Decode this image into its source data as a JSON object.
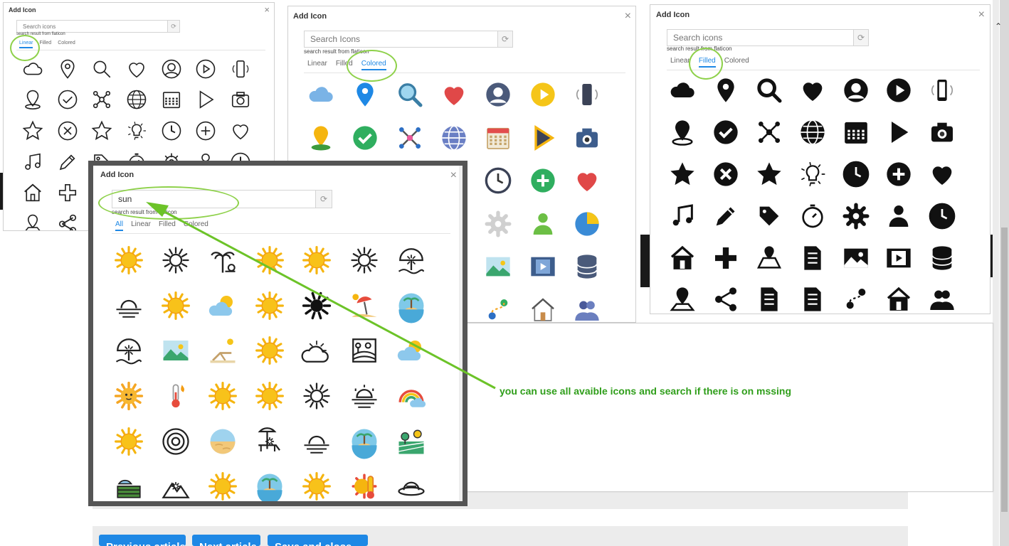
{
  "background": {
    "buttons": [
      "Previous article",
      "Next article",
      "Save and close"
    ]
  },
  "dialogs": {
    "linear": {
      "title": "Add Icon",
      "close": "×",
      "search_placeholder": "Search icons",
      "search_value": "",
      "source_note": "search result from flaticon",
      "tabs": [
        "Linear",
        "Filled",
        "Colored"
      ],
      "active_tab": "Linear",
      "icons": [
        "cloud-icon",
        "location-pin-icon",
        "search-icon",
        "heart-icon",
        "user-icon",
        "play-icon",
        "smartphone-icon",
        "map-pin-icon",
        "check-circle-icon",
        "network-icon",
        "globe-icon",
        "calendar-icon",
        "play-triangle-icon",
        "camera-icon",
        "star-icon",
        "close-circle-icon",
        "star-alt-icon",
        "lightbulb-icon",
        "clock-icon",
        "plus-circle-icon",
        "heart-alt-icon",
        "music-icon",
        "pencil-icon",
        "tag-icon",
        "stopwatch-icon",
        "gear-icon",
        "person-icon",
        "clock-alt-icon",
        "house-icon",
        "plus-icon",
        "",
        "",
        "",
        "",
        "",
        "pin-map-icon",
        "share-icon",
        "",
        "",
        "",
        "",
        ""
      ]
    },
    "colored": {
      "title": "Add Icon",
      "close": "×",
      "search_placeholder": "Search Icons",
      "search_value": "",
      "source_note": "search result from flaticon",
      "tabs": [
        "Linear",
        "Filled",
        "Colored"
      ],
      "active_tab": "Colored",
      "icons": [
        "cloud-icon",
        "location-pin-icon",
        "search-icon",
        "heart-icon",
        "user-icon",
        "play-icon",
        "smartphone-icon",
        "map-pin-icon",
        "check-circle-icon",
        "network-icon",
        "globe-icon",
        "calendar-icon",
        "play-triangle-icon",
        "camera-icon",
        "",
        "",
        "",
        "",
        "clock-icon",
        "plus-circle-icon",
        "heart-alt-icon",
        "",
        "",
        "",
        "",
        "gear-icon",
        "person-icon",
        "pie-chart-icon",
        "",
        "",
        "",
        "",
        "image-icon",
        "video-icon",
        "database-icon",
        "",
        "",
        "",
        "",
        "route-icon",
        "house-icon",
        "users-icon"
      ]
    },
    "filled": {
      "title": "Add Icon",
      "close": "×",
      "search_placeholder": "Search icons",
      "search_value": "",
      "source_note": "search result from flaticon",
      "tabs": [
        "Linear",
        "Filled",
        "Colored"
      ],
      "active_tab": "Filled",
      "icons": [
        "cloud-icon",
        "location-pin-icon",
        "search-icon",
        "heart-icon",
        "user-icon",
        "play-icon",
        "smartphone-icon",
        "map-pin-icon",
        "check-circle-icon",
        "network-icon",
        "globe-icon",
        "calendar-icon",
        "play-triangle-icon",
        "camera-icon",
        "star-icon",
        "close-circle-icon",
        "star-alt-icon",
        "lightbulb-icon",
        "clock-icon",
        "plus-circle-icon",
        "heart-alt-icon",
        "music-icon",
        "pencil-icon",
        "tag-icon",
        "stopwatch-icon",
        "gear-icon",
        "person-icon",
        "clock-alt-icon",
        "house-icon",
        "plus-icon",
        "map-icon",
        "checklist-icon",
        "image-icon",
        "video-icon",
        "database-icon",
        "pin-map-icon",
        "share-icon",
        "document-icon",
        "document-alt-icon",
        "route-icon",
        "home-icon",
        "users-icon"
      ]
    },
    "search": {
      "title": "Add Icon",
      "close": "×",
      "search_placeholder": "Search icons",
      "search_value": "sun",
      "source_note": "search result from flaticon",
      "tabs": [
        "All",
        "Linear",
        "Filled",
        "Colored"
      ],
      "active_tab": "All",
      "icons": [
        "sun-icon",
        "sun-outline-icon",
        "palm-tree-icon",
        "sun-icon",
        "sun-icon",
        "sun-outline-icon",
        "beach-umbrella-icon",
        "sunset-icon",
        "sun-icon",
        "cloud-sun-icon",
        "sun-icon",
        "sun-filled-icon",
        "beach-icon",
        "island-icon",
        "beach-umbrella-icon",
        "image-icon",
        "beach-chair-icon",
        "sun-icon",
        "cloud-sun-outline-icon",
        "landscape-sun-icon",
        "cloud-sun-icon",
        "sun-face-icon",
        "thermometer-icon",
        "sun-icon",
        "sun-icon",
        "sun-outline-icon",
        "sunrise-icon",
        "rainbow-icon",
        "sun-icon",
        "target-icon",
        "desert-icon",
        "sunbed-icon",
        "sunset-icon",
        "island-icon",
        "field-icon",
        "crop-icon",
        "mountain-icon",
        "sun-icon",
        "island-icon",
        "sun-icon",
        "thermometer-sun-icon",
        "hat-icon"
      ]
    }
  },
  "annotation": {
    "text": "you can use all avaible icons and search if there is on mssing"
  },
  "colors": {
    "accent": "#1e88e5",
    "highlight": "#8ed14a",
    "arrow": "#6cc328",
    "annotation_text": "#2f9e1a"
  }
}
